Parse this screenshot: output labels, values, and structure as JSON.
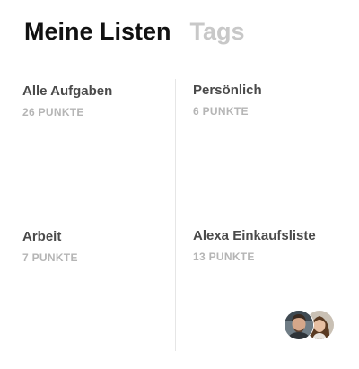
{
  "tabs": {
    "active": "Meine Listen",
    "inactive": "Tags"
  },
  "lists": [
    {
      "title": "Alle Aufgaben",
      "count": "26 PUNKTE"
    },
    {
      "title": "Persönlich",
      "count": "6 PUNKTE"
    },
    {
      "title": "Arbeit",
      "count": "7 PUNKTE"
    },
    {
      "title": "Alexa Einkaufsliste",
      "count": "13 PUNKTE"
    }
  ],
  "shared_avatars": [
    "avatar-man-icon",
    "avatar-woman-icon"
  ],
  "colors": {
    "active_tab": "#111111",
    "inactive_tab": "#c8c8c8",
    "list_title": "#4a4a4a",
    "list_count": "#b5b5b5",
    "divider": "#e6e6e6"
  }
}
